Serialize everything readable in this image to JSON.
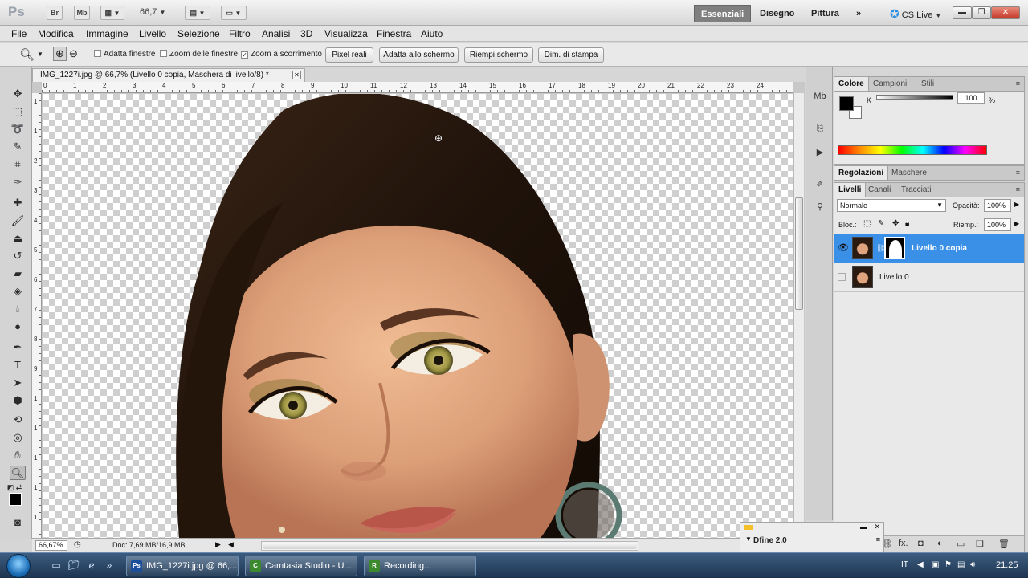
{
  "app": {
    "logo": "Ps",
    "bridge_label": "Br",
    "minibridge_label": "Mb",
    "zoom_value": "66,7"
  },
  "workspaces": [
    "Essenziali",
    "Disegno",
    "Pittura"
  ],
  "cs_live": "CS Live",
  "menu": [
    "File",
    "Modifica",
    "Immagine",
    "Livello",
    "Selezione",
    "Filtro",
    "Analisi",
    "3D",
    "Visualizza",
    "Finestra",
    "Aiuto"
  ],
  "options": {
    "adatta_finestre": "Adatta finestre",
    "zoom_finestre": "Zoom delle finestre",
    "zoom_scorrimento": "Zoom a scorrimento",
    "btn_pixel": "Pixel reali",
    "btn_adatta": "Adatta allo schermo",
    "btn_riempi": "Riempi schermo",
    "btn_stampa": "Dim. di stampa"
  },
  "document": {
    "tab_title": "IMG_1227i.jpg @ 66,7% (Livello 0 copia, Maschera di livello/8) *",
    "ruler_top": [
      "0",
      "1",
      "2",
      "3",
      "4",
      "5",
      "6",
      "7",
      "8",
      "9",
      "10",
      "11",
      "12",
      "13",
      "14",
      "15",
      "16",
      "17",
      "18",
      "19",
      "20",
      "21",
      "22",
      "23",
      "24"
    ],
    "ruler_left": [
      "1",
      "1",
      "2",
      "3",
      "4",
      "5",
      "6",
      "7",
      "8",
      "9",
      "1",
      "1",
      "1",
      "1",
      "1"
    ]
  },
  "status": {
    "zoom": "66,67%",
    "doc_info": "Doc: 7,69 MB/16,9 MB"
  },
  "color_panel": {
    "tabs": [
      "Colore",
      "Campioni",
      "Stili"
    ],
    "channel": "K",
    "value": "100",
    "unit": "%"
  },
  "adjust_panel": {
    "tabs": [
      "Regolazioni",
      "Maschere"
    ]
  },
  "layers_panel": {
    "tabs": [
      "Livelli",
      "Canali",
      "Tracciati"
    ],
    "blend_mode": "Normale",
    "opacity_label": "Opacità:",
    "opacity_value": "100%",
    "lock_label": "Bloc.:",
    "fill_label": "Riemp.:",
    "fill_value": "100%",
    "layers": [
      {
        "name": "Livello 0 copia",
        "selected": true,
        "visible": true
      },
      {
        "name": "Livello 0",
        "selected": false,
        "visible": false
      }
    ]
  },
  "dfine": {
    "title": "Dfine 2.0"
  },
  "taskbar": {
    "tasks": [
      {
        "label": "IMG_1227i.jpg @ 66,...",
        "icon": "Ps",
        "color": "#1b4f9c"
      },
      {
        "label": "Camtasia Studio - U...",
        "icon": "C",
        "color": "#3c8a2e"
      },
      {
        "label": "Recording...",
        "icon": "R",
        "color": "#3c8a2e"
      }
    ],
    "lang": "IT",
    "time": "21.25"
  },
  "colors": {
    "accent": "#3a8fe6",
    "hair": "#2a1a10",
    "skin": "#e0a57e"
  }
}
